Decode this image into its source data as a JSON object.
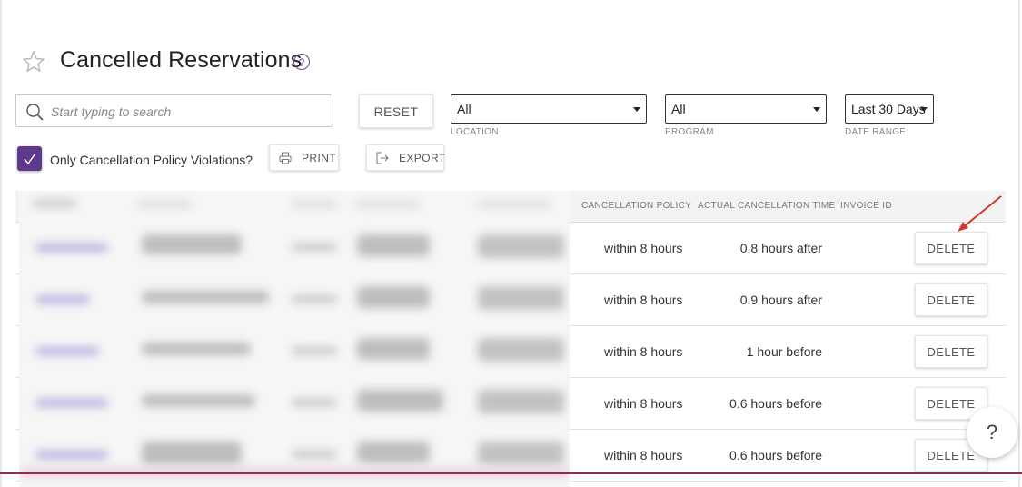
{
  "header": {
    "title": "Cancelled Reservations",
    "help_glyph": "?"
  },
  "filters": {
    "search_placeholder": "Start typing to search",
    "reset_label": "RESET",
    "location": {
      "value": "All",
      "label": "LOCATION"
    },
    "program": {
      "value": "All",
      "label": "PROGRAM"
    },
    "date_range": {
      "value": "Last 30 Days",
      "label": "DATE RANGE:"
    },
    "violations_checkbox": {
      "checked": true,
      "label": "Only Cancellation Policy Violations?"
    },
    "print_label": "PRINT",
    "export_label": "EXPORT"
  },
  "table": {
    "columns": {
      "cancellation_policy": "CANCELLATION POLICY",
      "actual_cancellation_time": "ACTUAL CANCELLATION TIME",
      "invoice_id": "INVOICE ID"
    },
    "rows": [
      {
        "policy": "within 8 hours",
        "actual": "0.8 hours after",
        "action": "DELETE"
      },
      {
        "policy": "within 8 hours",
        "actual": "0.9 hours after",
        "action": "DELETE"
      },
      {
        "policy": "within 8 hours",
        "actual": "1 hour before",
        "action": "DELETE"
      },
      {
        "policy": "within 8 hours",
        "actual": "0.6 hours before",
        "action": "DELETE"
      },
      {
        "policy": "within 8 hours",
        "actual": "0.6 hours before",
        "action": "DELETE"
      }
    ]
  },
  "floating_help": "?",
  "colors": {
    "accent": "#5e3a8c",
    "footer": "#8a2b5a",
    "arrow": "#d0392b"
  },
  "icons": [
    "star-icon",
    "help-icon",
    "search-icon",
    "printer-icon",
    "export-icon",
    "checkmark-icon"
  ]
}
